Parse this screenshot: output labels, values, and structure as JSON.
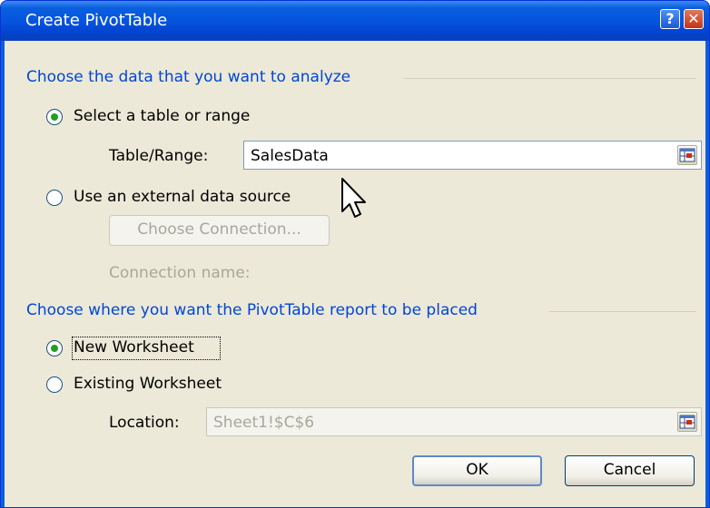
{
  "window": {
    "title": "Create PivotTable"
  },
  "section_data": {
    "heading": "Choose the data that you want to analyze",
    "option_table": "Select a table or range",
    "table_range_label": "Table/Range:",
    "table_range_value": "SalesData",
    "option_external": "Use an external data source",
    "choose_connection_label": "Choose Connection...",
    "connection_name_label": "Connection name:"
  },
  "section_placement": {
    "heading": "Choose where you want the PivotTable report to be placed",
    "option_new": "New Worksheet",
    "option_existing": "Existing Worksheet",
    "location_label": "Location:",
    "location_value": "Sheet1!$C$6"
  },
  "buttons": {
    "ok": "OK",
    "cancel": "Cancel"
  },
  "icons": [
    "help-icon",
    "close-icon",
    "range-selector-icon",
    "mouse-cursor-icon"
  ]
}
